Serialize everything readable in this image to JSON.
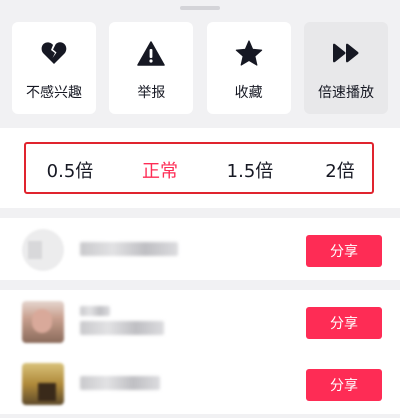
{
  "actions": [
    {
      "label": "不感兴趣",
      "icon": "broken-heart-icon"
    },
    {
      "label": "举报",
      "icon": "warning-icon"
    },
    {
      "label": "收藏",
      "icon": "star-icon"
    },
    {
      "label": "倍速播放",
      "icon": "fast-forward-icon",
      "active": true
    }
  ],
  "speed": {
    "options": [
      "0.5倍",
      "正常",
      "1.5倍",
      "2倍"
    ],
    "selected": "正常"
  },
  "share": {
    "button_label": "分享",
    "rows": [
      {
        "avatar": "blurred-avatar"
      },
      {
        "avatar": "blurred-avatar"
      },
      {
        "avatar": "blurred-avatar"
      }
    ]
  },
  "colors": {
    "accent": "#fe2c55",
    "highlight_border": "#e0242e"
  }
}
